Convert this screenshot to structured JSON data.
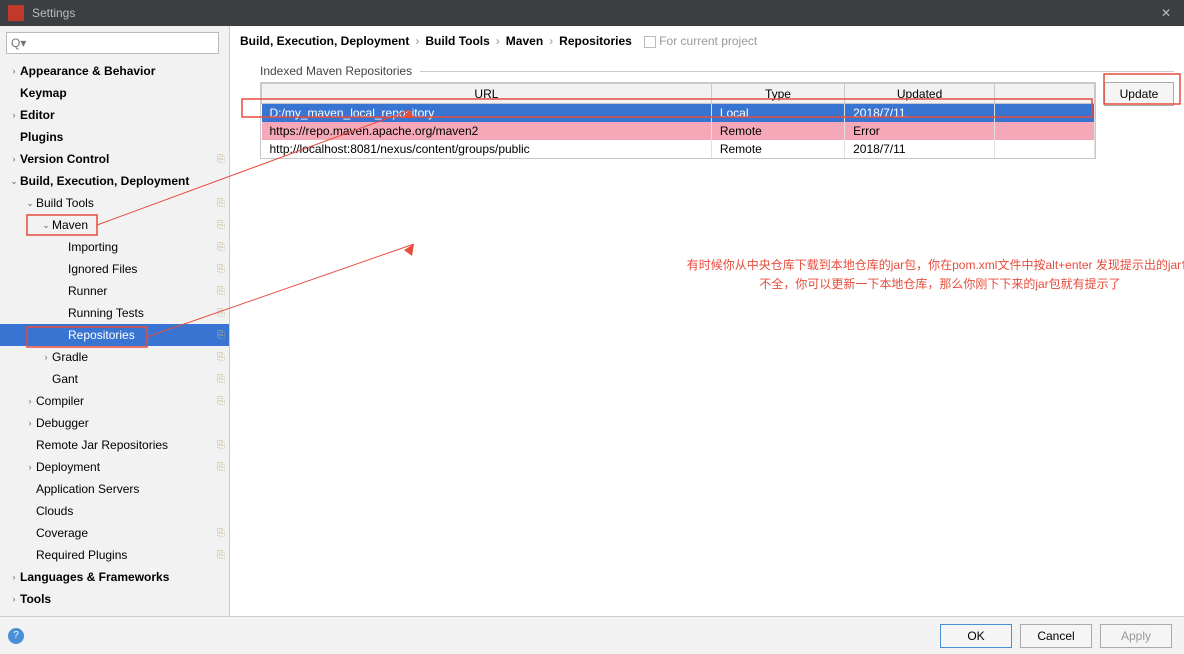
{
  "window": {
    "title": "Settings",
    "close_glyph": "✕"
  },
  "search": {
    "placeholder": "Q▾"
  },
  "tree": [
    {
      "label": "Appearance & Behavior",
      "bold": true,
      "arrow": "›",
      "depth": 0,
      "copy": false
    },
    {
      "label": "Keymap",
      "bold": true,
      "arrow": "",
      "depth": 0,
      "copy": false
    },
    {
      "label": "Editor",
      "bold": true,
      "arrow": "›",
      "depth": 0,
      "copy": false
    },
    {
      "label": "Plugins",
      "bold": true,
      "arrow": "",
      "depth": 0,
      "copy": false
    },
    {
      "label": "Version Control",
      "bold": true,
      "arrow": "›",
      "depth": 0,
      "copy": true
    },
    {
      "label": "Build, Execution, Deployment",
      "bold": true,
      "arrow": "⌄",
      "depth": 0,
      "copy": false
    },
    {
      "label": "Build Tools",
      "bold": false,
      "arrow": "⌄",
      "depth": 1,
      "copy": true
    },
    {
      "label": "Maven",
      "bold": false,
      "arrow": "⌄",
      "depth": 2,
      "copy": true,
      "boxed": true
    },
    {
      "label": "Importing",
      "bold": false,
      "arrow": "",
      "depth": 3,
      "copy": true
    },
    {
      "label": "Ignored Files",
      "bold": false,
      "arrow": "",
      "depth": 3,
      "copy": true
    },
    {
      "label": "Runner",
      "bold": false,
      "arrow": "",
      "depth": 3,
      "copy": true
    },
    {
      "label": "Running Tests",
      "bold": false,
      "arrow": "",
      "depth": 3,
      "copy": true
    },
    {
      "label": "Repositories",
      "bold": false,
      "arrow": "",
      "depth": 3,
      "copy": true,
      "selected": true,
      "boxed": true
    },
    {
      "label": "Gradle",
      "bold": false,
      "arrow": "›",
      "depth": 2,
      "copy": true
    },
    {
      "label": "Gant",
      "bold": false,
      "arrow": "",
      "depth": 2,
      "copy": true
    },
    {
      "label": "Compiler",
      "bold": false,
      "arrow": "›",
      "depth": 1,
      "copy": true
    },
    {
      "label": "Debugger",
      "bold": false,
      "arrow": "›",
      "depth": 1,
      "copy": false
    },
    {
      "label": "Remote Jar Repositories",
      "bold": false,
      "arrow": "",
      "depth": 1,
      "copy": true
    },
    {
      "label": "Deployment",
      "bold": false,
      "arrow": "›",
      "depth": 1,
      "copy": true
    },
    {
      "label": "Application Servers",
      "bold": false,
      "arrow": "",
      "depth": 1,
      "copy": false
    },
    {
      "label": "Clouds",
      "bold": false,
      "arrow": "",
      "depth": 1,
      "copy": false
    },
    {
      "label": "Coverage",
      "bold": false,
      "arrow": "",
      "depth": 1,
      "copy": true
    },
    {
      "label": "Required Plugins",
      "bold": false,
      "arrow": "",
      "depth": 1,
      "copy": true
    },
    {
      "label": "Languages & Frameworks",
      "bold": true,
      "arrow": "›",
      "depth": 0,
      "copy": false
    },
    {
      "label": "Tools",
      "bold": true,
      "arrow": "›",
      "depth": 0,
      "copy": false
    }
  ],
  "breadcrumb": {
    "parts": [
      "Build, Execution, Deployment",
      "Build Tools",
      "Maven",
      "Repositories"
    ],
    "sep": "›",
    "for_project": "For current project"
  },
  "section": {
    "label": "Indexed Maven Repositories"
  },
  "table": {
    "headers": [
      "URL",
      "Type",
      "Updated"
    ],
    "rows": [
      {
        "url": "D:/my_maven_local_repository",
        "type": "Local",
        "updated": "2018/7/11",
        "selected": true
      },
      {
        "url": "https://repo.maven.apache.org/maven2",
        "type": "Remote",
        "updated": "Error",
        "error": true
      },
      {
        "url": "http://localhost:8081/nexus/content/groups/public",
        "type": "Remote",
        "updated": "2018/7/11"
      }
    ]
  },
  "buttons": {
    "update": "Update",
    "ok": "OK",
    "cancel": "Cancel",
    "apply": "Apply",
    "help": "?"
  },
  "annotation": {
    "line1": "有时候你从中央仓库下载到本地仓库的jar包，你在pom.xml文件中按alt+enter 发现提示出的jar包",
    "line2": "不全，你可以更新一下本地仓库，那么你刚下下来的jar包就有提示了"
  },
  "watermark": ""
}
